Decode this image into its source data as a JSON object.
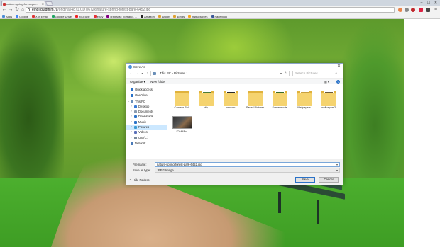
{
  "browser": {
    "tab_title": "nature-spring-forest-par...",
    "url_host": "eingl.guidtfilm.ru",
    "url_path": "/original/4871.CD7/672x/nature-spring-forest-park-6452.jpg",
    "bookmarks": [
      {
        "label": "Apps",
        "color": "#4a8cd6"
      },
      {
        "label": "Google",
        "color": "#4285f4"
      },
      {
        "label": "XIX Email",
        "color": "#d33"
      },
      {
        "label": "Google Drive",
        "color": "#1fa463"
      },
      {
        "label": "YouTube",
        "color": "#e22"
      },
      {
        "label": "ebay",
        "color": "#e53238"
      },
      {
        "label": "craigslist: portland, ...",
        "color": "#800080"
      },
      {
        "label": "Amazon",
        "color": "#222"
      },
      {
        "label": "Attoori",
        "color": "#e0a030"
      },
      {
        "label": "songs",
        "color": "#e0a030"
      },
      {
        "label": "instructables",
        "color": "#f8a51b"
      },
      {
        "label": "Facebook",
        "color": "#3b5998"
      }
    ]
  },
  "dialog": {
    "title": "Save As",
    "breadcrumb": "This PC  ›  Pictures  ›",
    "search_placeholder": "Search Pictures",
    "organize_label": "Organize ▾",
    "new_folder_label": "New folder",
    "sidebar": [
      {
        "label": "Quick access",
        "level": 0,
        "icon": "star-icon",
        "color": "#2a72c8"
      },
      {
        "label": "OneDrive",
        "level": 0,
        "icon": "cloud-icon",
        "color": "#2a72c8"
      },
      {
        "label": "This PC",
        "level": 0,
        "icon": "pc-icon",
        "color": "#6a8fb8"
      },
      {
        "label": "Desktop",
        "level": 1,
        "icon": "desktop-icon",
        "color": "#3a7bd5"
      },
      {
        "label": "Documents",
        "level": 1,
        "icon": "documents-icon",
        "color": "#8a9bb0"
      },
      {
        "label": "Downloads",
        "level": 1,
        "icon": "downloads-icon",
        "color": "#2a72c8"
      },
      {
        "label": "Music",
        "level": 1,
        "icon": "music-icon",
        "color": "#2a72c8"
      },
      {
        "label": "Pictures",
        "level": 1,
        "icon": "pictures-icon",
        "color": "#3a9bd5",
        "selected": true
      },
      {
        "label": "Videos",
        "level": 1,
        "icon": "videos-icon",
        "color": "#5a6fb8"
      },
      {
        "label": "OS (C:)",
        "level": 1,
        "icon": "drive-icon",
        "color": "#7a8a9a"
      },
      {
        "label": "Network",
        "level": 0,
        "icon": "network-icon",
        "color": "#4a7ab8"
      }
    ],
    "files": [
      {
        "name": "Camera Roll",
        "kind": "folder"
      },
      {
        "name": "diy",
        "kind": "folder-img"
      },
      {
        "name": "random",
        "kind": "folder-img"
      },
      {
        "name": "Saved Pictures",
        "kind": "folder"
      },
      {
        "name": "Screenshots",
        "kind": "folder-img"
      },
      {
        "name": "Wallpapers",
        "kind": "folder-img"
      },
      {
        "name": "wallpapers2",
        "kind": "folder-img"
      },
      {
        "name": "IC644Rn",
        "kind": "image"
      }
    ],
    "file_name_label": "File name:",
    "file_name_value": "nature-spring-forest-park-6452.jpg",
    "save_type_label": "Save as type:",
    "save_type_value": "JPEG Image",
    "hide_folders_label": "Hide Folders",
    "save_label": "Save",
    "cancel_label": "Cancel"
  }
}
